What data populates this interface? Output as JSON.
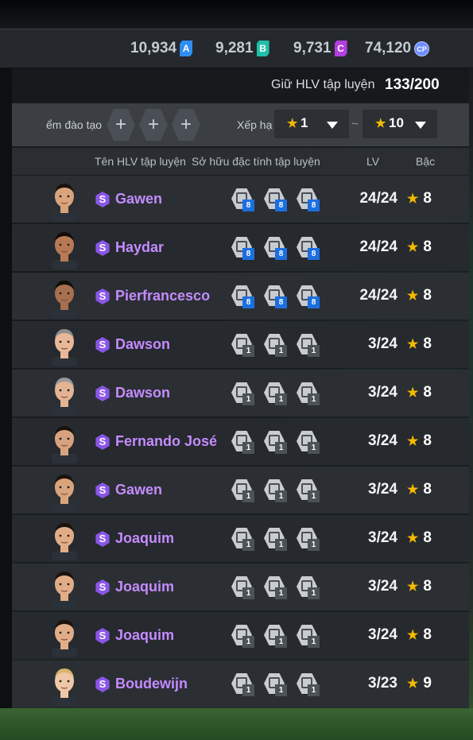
{
  "currencies": [
    {
      "value": "10,934",
      "badge": "A",
      "color": "#2f8df5"
    },
    {
      "value": "9,281",
      "badge": "B",
      "color": "#20c0a8"
    },
    {
      "value": "9,731",
      "badge": "C",
      "color": "#b23fe0"
    },
    {
      "value": "74,120",
      "badge": "CP",
      "color": "#6e8dff"
    }
  ],
  "summary": {
    "label": "Giữ HLV tập luyện",
    "count": "133/200"
  },
  "filters": {
    "training_label": "ểm đào tạo",
    "plus_label": "+",
    "sort_label": "Xếp hạ",
    "from_value": "1",
    "to_value": "10",
    "range_separator": "~"
  },
  "columns": {
    "name": "Tên HLV tập luyện",
    "traits": "Sở hữu đặc tính tập luyện",
    "lv": "LV",
    "rank": "Bậc"
  },
  "coaches": [
    {
      "name": "Gawen",
      "trait_levels": [
        "8",
        "8",
        "8"
      ],
      "lv": "24/24",
      "rank": "8"
    },
    {
      "name": "Haydar",
      "trait_levels": [
        "8",
        "8",
        "8"
      ],
      "lv": "24/24",
      "rank": "8"
    },
    {
      "name": "Pierfrancesco",
      "trait_levels": [
        "8",
        "8",
        "8"
      ],
      "lv": "24/24",
      "rank": "8"
    },
    {
      "name": "Dawson",
      "trait_levels": [
        "1",
        "1",
        "1"
      ],
      "lv": "3/24",
      "rank": "8"
    },
    {
      "name": "Dawson",
      "trait_levels": [
        "1",
        "1",
        "1"
      ],
      "lv": "3/24",
      "rank": "8"
    },
    {
      "name": "Fernando José",
      "trait_levels": [
        "1",
        "1",
        "1"
      ],
      "lv": "3/24",
      "rank": "8"
    },
    {
      "name": "Gawen",
      "trait_levels": [
        "1",
        "1",
        "1"
      ],
      "lv": "3/24",
      "rank": "8"
    },
    {
      "name": "Joaquim",
      "trait_levels": [
        "1",
        "1",
        "1"
      ],
      "lv": "3/24",
      "rank": "8"
    },
    {
      "name": "Joaquim",
      "trait_levels": [
        "1",
        "1",
        "1"
      ],
      "lv": "3/24",
      "rank": "8"
    },
    {
      "name": "Joaquim",
      "trait_levels": [
        "1",
        "1",
        "1"
      ],
      "lv": "3/24",
      "rank": "8"
    },
    {
      "name": "Boudewijn",
      "trait_levels": [
        "1",
        "1",
        "1"
      ],
      "lv": "3/23",
      "rank": "9"
    }
  ],
  "icons": {
    "season_badge": "S",
    "star": "★"
  }
}
